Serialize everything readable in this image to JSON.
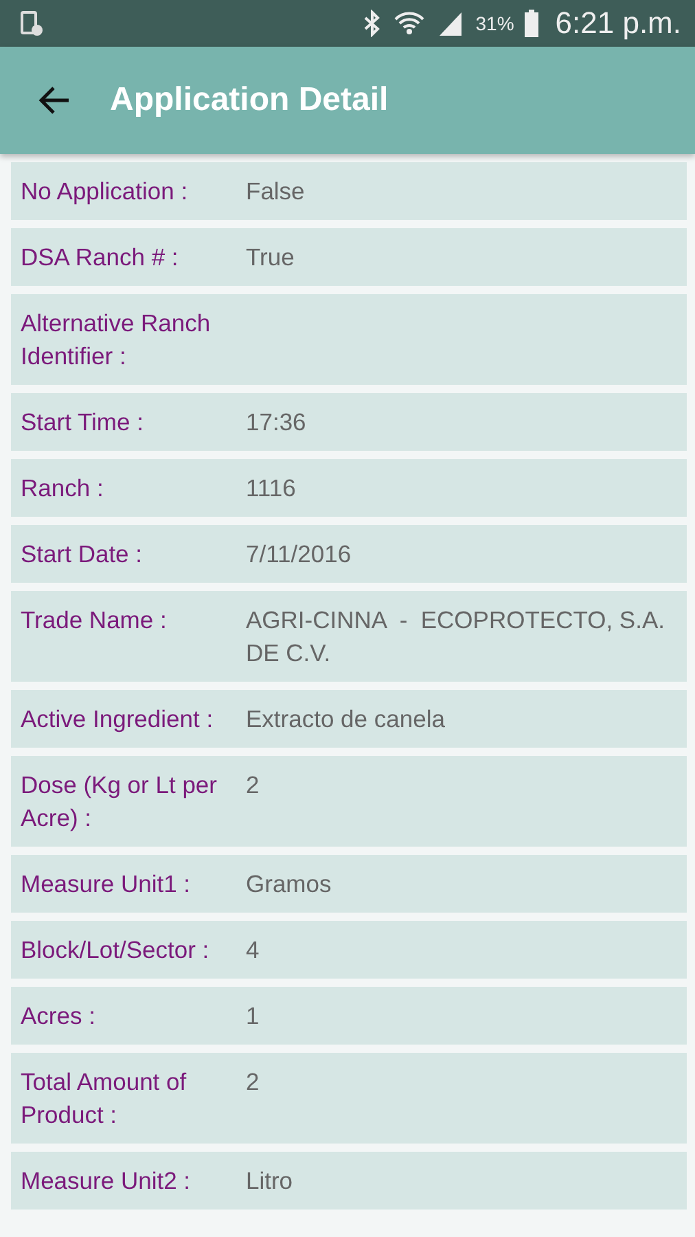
{
  "status_bar": {
    "battery": "31%",
    "time": "6:21 p.m."
  },
  "app_bar": {
    "title": "Application Detail"
  },
  "fields": [
    {
      "label": "No Application :",
      "value": "False"
    },
    {
      "label": "DSA Ranch # :",
      "value": "True"
    },
    {
      "label": "Alternative Ranch Identifier :"
    },
    {
      "label": "Start Time :",
      "value": "17:36"
    },
    {
      "label": "Ranch :",
      "value": "1116"
    },
    {
      "label": "Start Date :",
      "value": "7/11/2016"
    },
    {
      "label": "Trade Name :",
      "value": "AGRI-CINNA  -  ECOPROTECTO, S.A. DE C.V."
    },
    {
      "label": "Active Ingredient :",
      "value": "Extracto de canela"
    },
    {
      "label": "Dose (Kg or Lt per Acre) :",
      "value": "2"
    },
    {
      "label": "Measure Unit1 :",
      "value": "Gramos"
    },
    {
      "label": "Block/Lot/Sector :",
      "value": "4"
    },
    {
      "label": "Acres :",
      "value": "1"
    },
    {
      "label": "Total Amount of Product :",
      "value": "2"
    },
    {
      "label": "Measure Unit2 :",
      "value": "Litro"
    }
  ]
}
